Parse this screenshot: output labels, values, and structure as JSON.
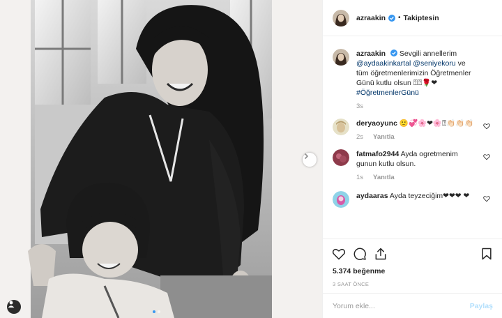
{
  "header": {
    "username": "azraakin",
    "separator": "•",
    "follow_status": "Takiptesin"
  },
  "caption": {
    "username": "azraakin",
    "text_1": "Sevgili annellerim",
    "mention_1": "@aydaakinkartal",
    "mention_2": "@seniyekoru",
    "text_2": "ve tüm öğretmenlerimizin Öğretmenler Günü kutlu olsun",
    "emoji": "⍰⍰🌹❤",
    "hashtag": "#ÖğretmenlerGünü",
    "time": "3s"
  },
  "comments": [
    {
      "username": "deryaoyunc",
      "text": "🙂💞🌸❤🌸⍰👏🏻👏🏻👏🏻",
      "time": "2s",
      "reply": "Yanıtla"
    },
    {
      "username": "fatmafo2944",
      "text": "Ayda ogretmenim gunun kutlu olsun.",
      "time": "1s",
      "reply": "Yanıtla"
    },
    {
      "username": "aydaaras",
      "text": "Ayda teyzeciğim❤❤❤ ❤",
      "time": "",
      "reply": ""
    }
  ],
  "actions": {
    "likes": "5.374 beğenme",
    "time_ago": "3 SAAT ÖNCE"
  },
  "comment_box": {
    "placeholder": "Yorum ekle...",
    "post_label": "Paylaş"
  },
  "colors": {
    "link": "#003569",
    "verified": "#3897f0",
    "post_disabled": "#b2dffc",
    "heart": "#ed4956"
  },
  "icons": [
    "chevron-right-icon",
    "user-tag-icon",
    "verified-icon",
    "heart-icon",
    "comment-icon",
    "share-icon",
    "bookmark-icon"
  ]
}
